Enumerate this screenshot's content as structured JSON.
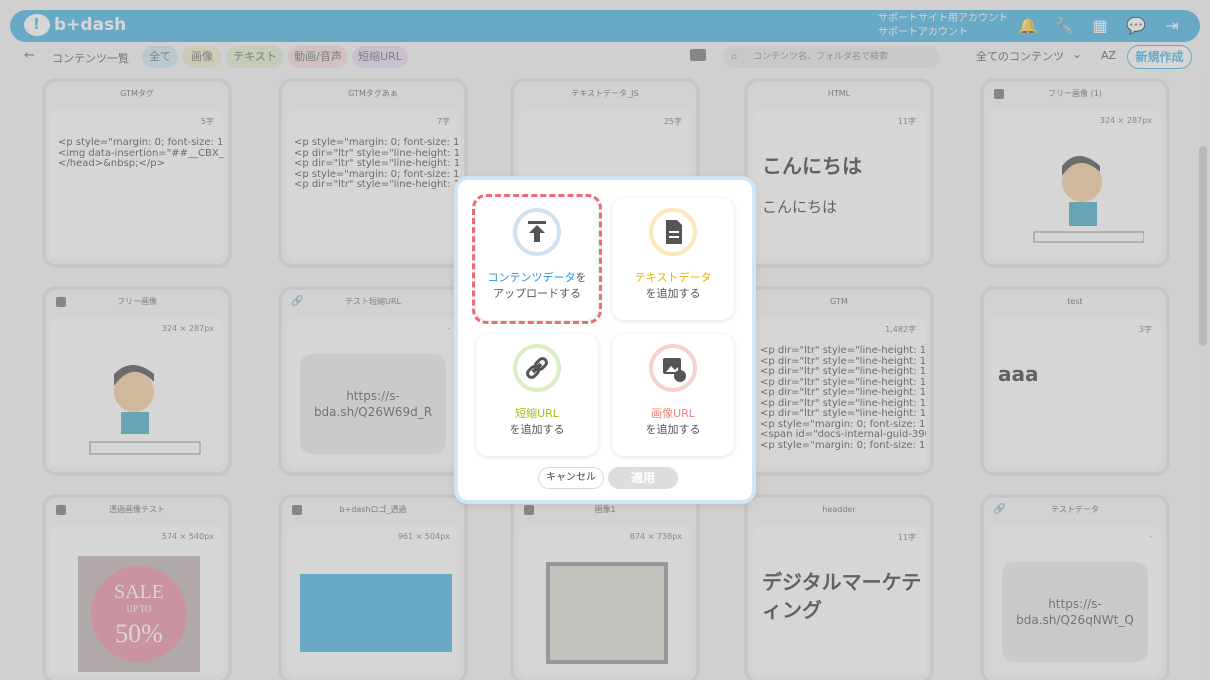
{
  "header": {
    "brand": "b+dash",
    "account_line1": "サポートサイト用アカウント",
    "account_line2": "サポートアカウント",
    "icons": [
      "bell-icon",
      "wrench-icon",
      "grid-icon",
      "chat-icon",
      "logout-icon"
    ]
  },
  "toolbar": {
    "back": "←",
    "title": "コンテンツ一覧",
    "filters": [
      "全て",
      "画像",
      "テキスト",
      "動画/音声",
      "短縮URL"
    ],
    "search_placeholder": "コンテンツ名、フォルダ名で検索",
    "select_value": "全てのコンテンツ",
    "az": "AZ",
    "new_button": "新規作成"
  },
  "cards": [
    {
      "title": "GTMタグ",
      "meta": "5字",
      "code": "<p style=\"margin: 0; font-size: 18\n<img data-insertion=\"##__CBX_IN\n</head>&nbsp;</p>"
    },
    {
      "title": "GTMタグあぁ",
      "meta": "7字",
      "code": "<p style=\"margin: 0; font-size: 18\n<p dir=\"ltr\" style=\"line-height: 1\n<p dir=\"ltr\" style=\"line-height: 1\n<p style=\"margin: 0; font-size: 18\n<p dir=\"ltr\" style=\"line-height: 1"
    },
    {
      "title": "テキストデータ_JS",
      "meta": "25字"
    },
    {
      "title": "HTML",
      "meta": "11字",
      "big": "こんにちは",
      "small": "こんにちは"
    },
    {
      "title": "フリー画像 (1)",
      "meta": "324 × 287px"
    },
    {
      "title": "フリー画像",
      "meta": "324 × 287px"
    },
    {
      "title": "テスト短縮URL",
      "meta": "-",
      "url": "https://s-bda.sh/Q26W69d_R"
    },
    {
      "title": "GTM",
      "meta": "1,482字",
      "code": "<p dir=\"ltr\" style=\"line-height: 1\n<p dir=\"ltr\" style=\"line-height: 1\n<p dir=\"ltr\" style=\"line-height: 1\n<p dir=\"ltr\" style=\"line-height: 1\n<p dir=\"ltr\" style=\"line-height: 1\n<p dir=\"ltr\" style=\"line-height: 1\n<p dir=\"ltr\" style=\"line-height: 1\n<p style=\"margin: 0; font-size: 18\n<span id=\"docs-internal-guid-390\n<p style=\"margin: 0; font-size: 18"
    },
    {
      "title": "test",
      "meta": "3字",
      "big": "aaa"
    },
    {
      "title": "透過画像テスト",
      "meta": "574 × 540px"
    },
    {
      "title": "b+dashロゴ_透過",
      "meta": "961 × 504px"
    },
    {
      "title": "画像1",
      "meta": "874 × 738px"
    },
    {
      "title": "headder",
      "meta": "11字",
      "big": "デジタルマーケティング"
    },
    {
      "title": "テストデータ",
      "meta": "-",
      "url": "https://s-bda.sh/Q26qNWt_Q"
    }
  ],
  "modal": {
    "upload": {
      "title": "コンテンツデータ",
      "suffix": "を",
      "line2": "アップロードする"
    },
    "text": {
      "title": "テキストデータ",
      "line2": "を追加する"
    },
    "url": {
      "title": "短縮URL",
      "line2": "を追加する"
    },
    "image": {
      "title": "画像URL",
      "line2": "を追加する"
    },
    "cancel": "キャンセル",
    "apply": "適用"
  }
}
